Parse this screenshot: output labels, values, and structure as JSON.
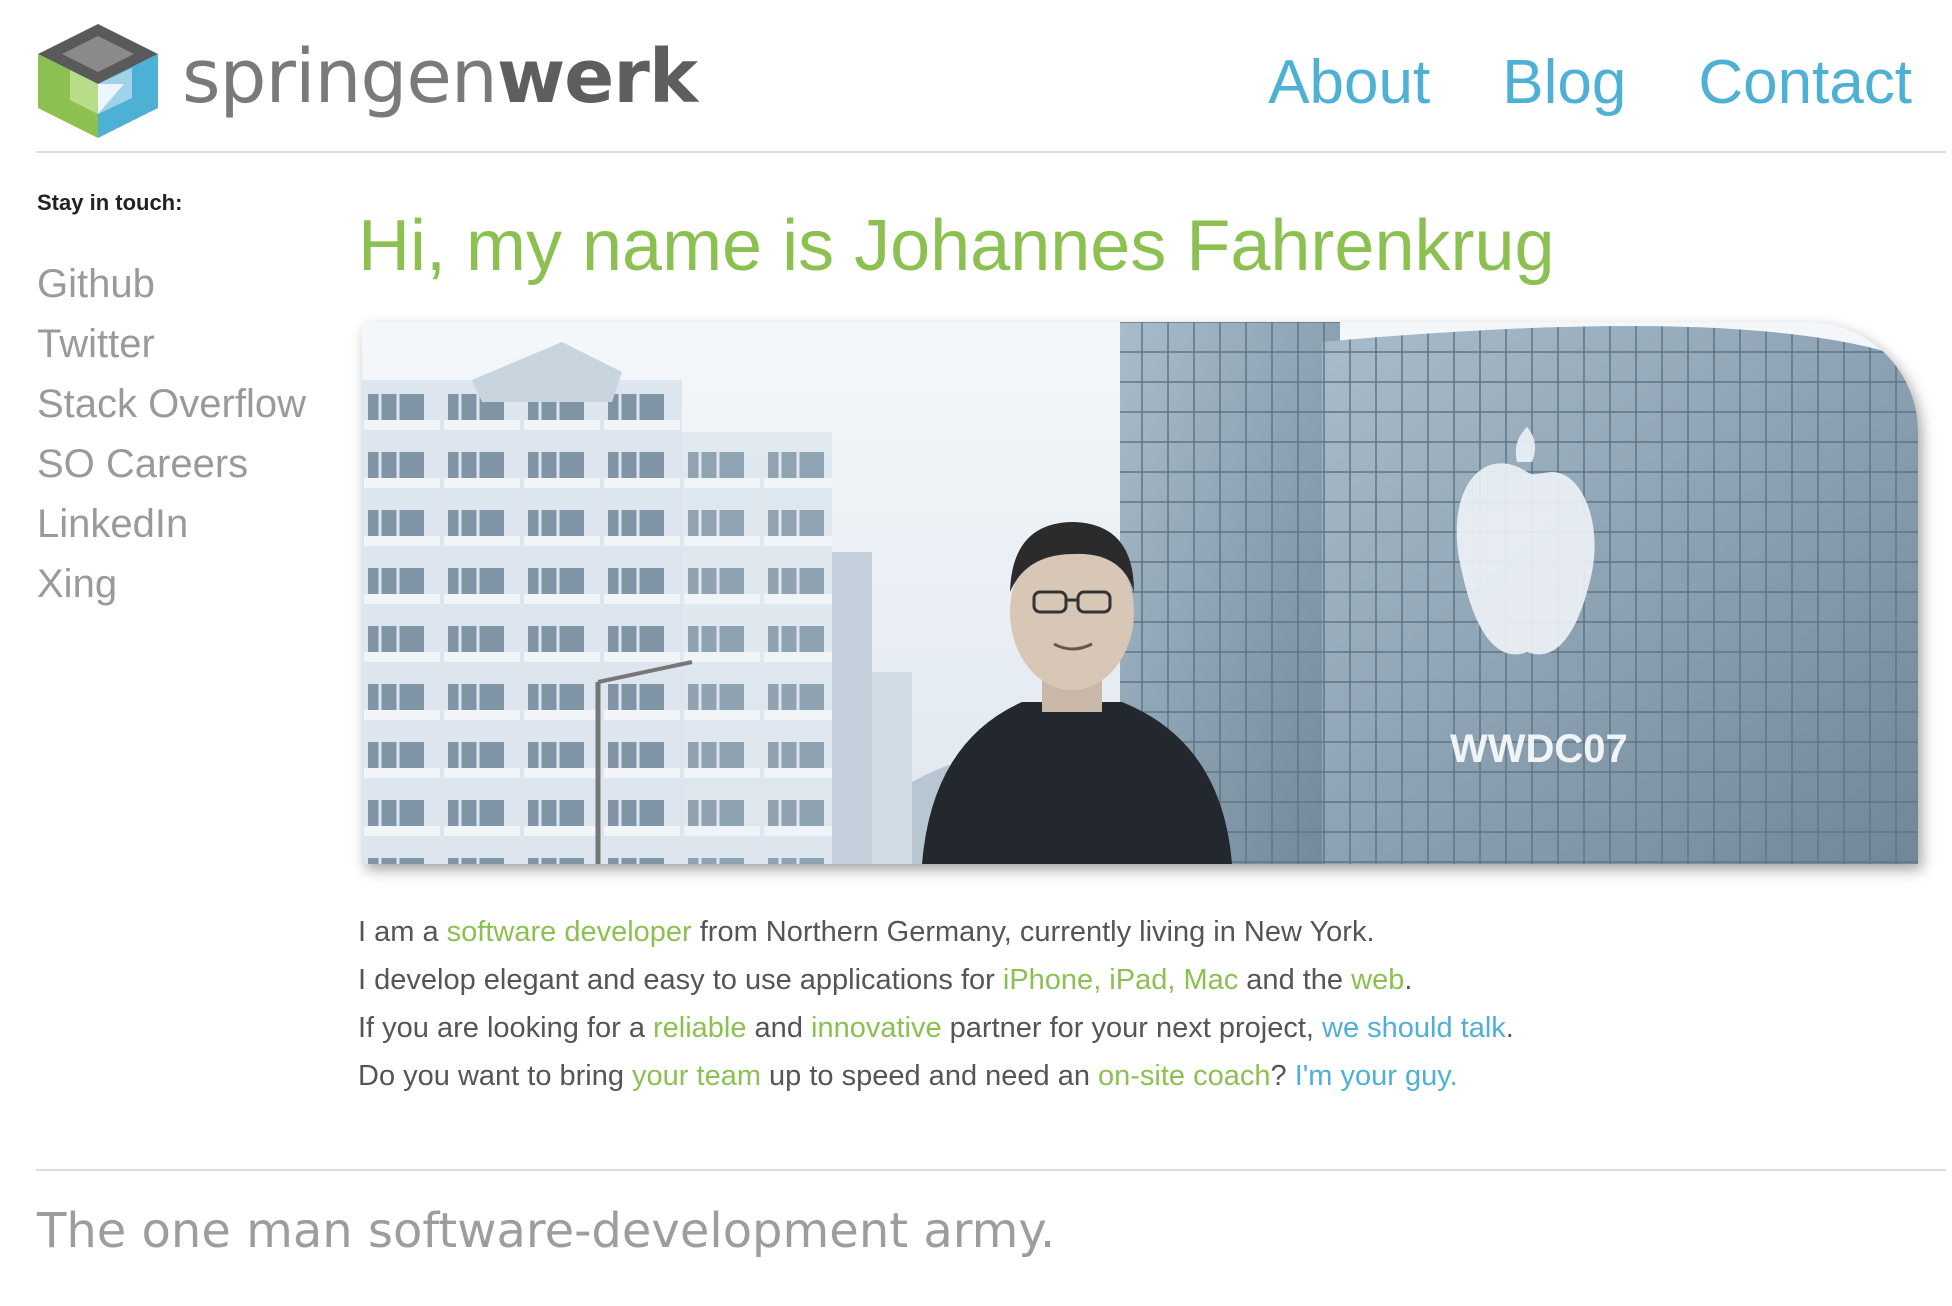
{
  "header": {
    "brand_light": "springen",
    "brand_bold": "werk",
    "nav": [
      "About",
      "Blog",
      "Contact"
    ]
  },
  "sidebar": {
    "heading": "Stay in touch:",
    "links": [
      "Github",
      "Twitter",
      "Stack Overflow",
      "SO Careers",
      "LinkedIn",
      "Xing"
    ]
  },
  "main": {
    "title": "Hi, my name is Johannes Fahrenkrug",
    "photo_sign": "WWDC07",
    "intro": {
      "l1": {
        "a": "I am a ",
        "b": "software developer",
        "c": " from Northern Germany, currently living in New York."
      },
      "l2": {
        "a": "I develop elegant and easy to use applications for ",
        "b": "iPhone, iPad, Mac",
        "c": " and the ",
        "d": "web",
        "e": "."
      },
      "l3": {
        "a": "If you are looking for a ",
        "b": "reliable",
        "c": " and ",
        "d": "innovative",
        "e": " partner for your next project, ",
        "f": "we should talk",
        "g": "."
      },
      "l4": {
        "a": "Do you want to bring ",
        "b": "your team",
        "c": " up to speed and need an ",
        "d": "on-site coach",
        "e": "? ",
        "f": "I'm your guy."
      }
    }
  },
  "footer": {
    "tagline": "The one man software-development army."
  },
  "colors": {
    "accent_green": "#8cc152",
    "accent_blue": "#4fb0d6",
    "muted_gray": "#9a9a9a"
  }
}
